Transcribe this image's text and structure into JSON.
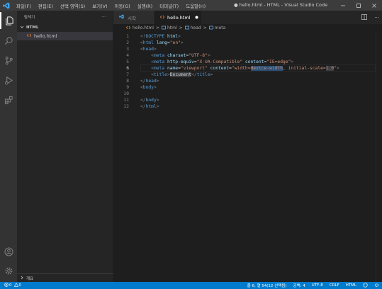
{
  "window": {
    "title": "● hello.html - HTML - Visual Studio Code",
    "menu": [
      "파일(F)",
      "편집(E)",
      "선택 영역(S)",
      "보기(V)",
      "이동(G)",
      "실행(R)",
      "터미널(T)",
      "도움말(H)"
    ]
  },
  "sidebar": {
    "header": "탐색기",
    "more": "···",
    "section": "HTML",
    "files": [
      "hello.html"
    ],
    "outline": "개요"
  },
  "tabs": [
    {
      "label": "시작",
      "active": false,
      "dirty": false
    },
    {
      "label": "hello.html",
      "active": true,
      "dirty": true
    }
  ],
  "breadcrumb": {
    "file": "hello.html",
    "sep": ">",
    "items": [
      "html",
      "head",
      "meta"
    ]
  },
  "editor": {
    "active_line": 6,
    "lines": [
      {
        "n": "1",
        "tokens": [
          [
            "t-pun",
            "<!"
          ],
          [
            "t-tag",
            "DOCTYPE"
          ],
          [
            "t-txt",
            " "
          ],
          [
            "t-att",
            "html"
          ],
          [
            "t-pun",
            ">"
          ]
        ]
      },
      {
        "n": "2",
        "tokens": [
          [
            "t-pun",
            "<"
          ],
          [
            "t-tag",
            "html"
          ],
          [
            "t-txt",
            " "
          ],
          [
            "t-att",
            "lang"
          ],
          [
            "t-txt",
            "="
          ],
          [
            "t-str",
            "\"en\""
          ],
          [
            "t-pun",
            ">"
          ]
        ]
      },
      {
        "n": "3",
        "tokens": [
          [
            "t-pun",
            "<"
          ],
          [
            "t-tag",
            "head"
          ],
          [
            "t-pun",
            ">"
          ]
        ]
      },
      {
        "n": "4",
        "tokens": [
          [
            "t-txt",
            "    "
          ],
          [
            "t-pun",
            "<"
          ],
          [
            "t-tag",
            "meta"
          ],
          [
            "t-txt",
            " "
          ],
          [
            "t-att",
            "charset"
          ],
          [
            "t-txt",
            "="
          ],
          [
            "t-str",
            "\"UTF-8\""
          ],
          [
            "t-pun",
            ">"
          ]
        ]
      },
      {
        "n": "5",
        "tokens": [
          [
            "t-txt",
            "    "
          ],
          [
            "t-pun",
            "<"
          ],
          [
            "t-tag",
            "meta"
          ],
          [
            "t-txt",
            " "
          ],
          [
            "t-att",
            "http-equiv"
          ],
          [
            "t-txt",
            "="
          ],
          [
            "t-str",
            "\"X-UA-Compatible\""
          ],
          [
            "t-txt",
            " "
          ],
          [
            "t-att",
            "content"
          ],
          [
            "t-txt",
            "="
          ],
          [
            "t-str",
            "\"IE=edge\""
          ],
          [
            "t-pun",
            ">"
          ]
        ]
      },
      {
        "n": "6",
        "tokens": [
          [
            "t-txt",
            "    "
          ],
          [
            "t-pun",
            "<"
          ],
          [
            "t-tag",
            "meta"
          ],
          [
            "t-txt",
            " "
          ],
          [
            "t-att",
            "name"
          ],
          [
            "t-txt",
            "="
          ],
          [
            "t-str",
            "\"viewport\""
          ],
          [
            "t-txt",
            " "
          ],
          [
            "t-att",
            "content"
          ],
          [
            "t-txt",
            "="
          ],
          [
            "t-str",
            "\"width="
          ],
          [
            "t-str sel",
            "device-width"
          ],
          [
            "t-str",
            ", initial-scale="
          ],
          [
            "t-str hl",
            "1.0"
          ],
          [
            "t-str",
            "\""
          ],
          [
            "t-pun",
            ">"
          ]
        ]
      },
      {
        "n": "7",
        "tokens": [
          [
            "t-txt",
            "    "
          ],
          [
            "t-pun",
            "<"
          ],
          [
            "t-tag",
            "title"
          ],
          [
            "t-pun",
            ">"
          ],
          [
            "t-txt hl",
            "Document"
          ],
          [
            "t-pun",
            "</"
          ],
          [
            "t-tag",
            "title"
          ],
          [
            "t-pun",
            ">"
          ]
        ]
      },
      {
        "n": "8",
        "tokens": [
          [
            "t-pun",
            "</"
          ],
          [
            "t-tag",
            "head"
          ],
          [
            "t-pun",
            ">"
          ]
        ]
      },
      {
        "n": "9",
        "tokens": [
          [
            "t-pun",
            "<"
          ],
          [
            "t-tag",
            "body"
          ],
          [
            "t-pun",
            ">"
          ]
        ]
      },
      {
        "n": "10",
        "tokens": [
          [
            "t-txt",
            "    "
          ]
        ]
      },
      {
        "n": "11",
        "tokens": [
          [
            "t-pun",
            "</"
          ],
          [
            "t-tag",
            "body"
          ],
          [
            "t-pun",
            ">"
          ]
        ]
      },
      {
        "n": "12",
        "tokens": [
          [
            "t-pun",
            "</"
          ],
          [
            "t-tag",
            "html"
          ],
          [
            "t-pun",
            ">"
          ]
        ]
      }
    ]
  },
  "statusbar": {
    "errors": "0",
    "warnings": "0",
    "position": "줄 6, 열 54(12 선택됨)",
    "indent": "공백: 4",
    "encoding": "UTF-8",
    "eol": "CRLF",
    "language": "HTML"
  },
  "colors": {
    "accent": "#007acc",
    "activitybar": "#333333",
    "sidebar": "#252526",
    "editor": "#1e1e1e",
    "titlebar": "#3c3c3c"
  }
}
